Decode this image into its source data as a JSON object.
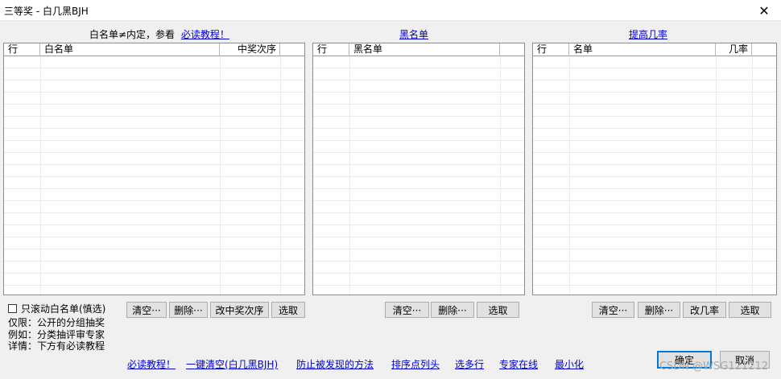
{
  "window": {
    "title": "三等奖 - 白几黑BJH",
    "close_glyph": "✕"
  },
  "whitelist": {
    "note_prefix": "白名单≠内定，参看",
    "note_link": "必读教程！",
    "columns": [
      "行",
      "白名单",
      "中奖次序"
    ],
    "buttons": {
      "clear": "清空···",
      "delete": "删除···",
      "change_order": "改中奖次序",
      "pick": "选取"
    },
    "scroll_only_checkbox": "只滚动白名单(慎选)",
    "info_lines": [
      "仅限：公开的分组抽奖",
      "例如：分类抽评审专家",
      "详情：下方有必读教程"
    ]
  },
  "blacklist": {
    "header_link": "黑名单",
    "columns": [
      "行",
      "黑名单"
    ],
    "buttons": {
      "clear": "清空···",
      "delete": "删除···",
      "pick": "选取"
    }
  },
  "probability": {
    "header_link": "提高几率",
    "columns": [
      "行",
      "名单",
      "几率"
    ],
    "buttons": {
      "clear": "清空···",
      "delete": "删除···",
      "change_rate": "改几率",
      "pick": "选取"
    }
  },
  "footer_links": [
    "必读教程！",
    "一键清空(白几黑BJH)",
    "防止被发现的方法",
    "排序点列头",
    "选多行",
    "专家在线",
    "最小化"
  ],
  "dialog_buttons": {
    "ok": "确定",
    "cancel": "取消"
  },
  "watermark": "CSDN @WSG121212"
}
